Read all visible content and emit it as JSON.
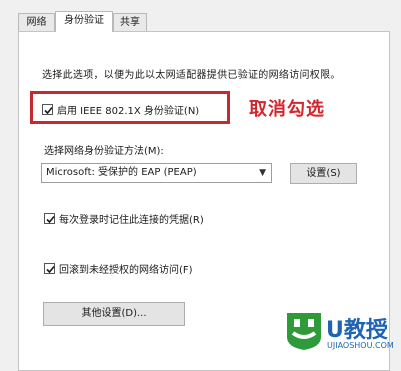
{
  "tabs": [
    "网络",
    "身份验证",
    "共享"
  ],
  "description": "选择此选项，以便为此以太网适配器提供已验证的网络访问权限。",
  "enable_8021x": {
    "label": "启用 IEEE 802.1X 身份验证(N)",
    "checked": true
  },
  "annotation": "取消勾选",
  "method_label": "选择网络身份验证方法(M):",
  "method_select": {
    "value": "Microsoft: 受保护的 EAP (PEAP)"
  },
  "settings_button": "设置(S)",
  "remember_credentials": {
    "label": "每次登录时记住此连接的凭据(R)",
    "checked": true
  },
  "fallback_unauthorized": {
    "label": "回滚到未经授权的网络访问(F)",
    "checked": true
  },
  "other_settings_button": "其他设置(D)...",
  "watermark": {
    "brand": "U教授",
    "site": "UJIAOSHOU.COM"
  },
  "colors": {
    "annotation_red": "#c8282f",
    "logo_green": "#2e9a3a",
    "logo_blue": "#1e63b4"
  }
}
